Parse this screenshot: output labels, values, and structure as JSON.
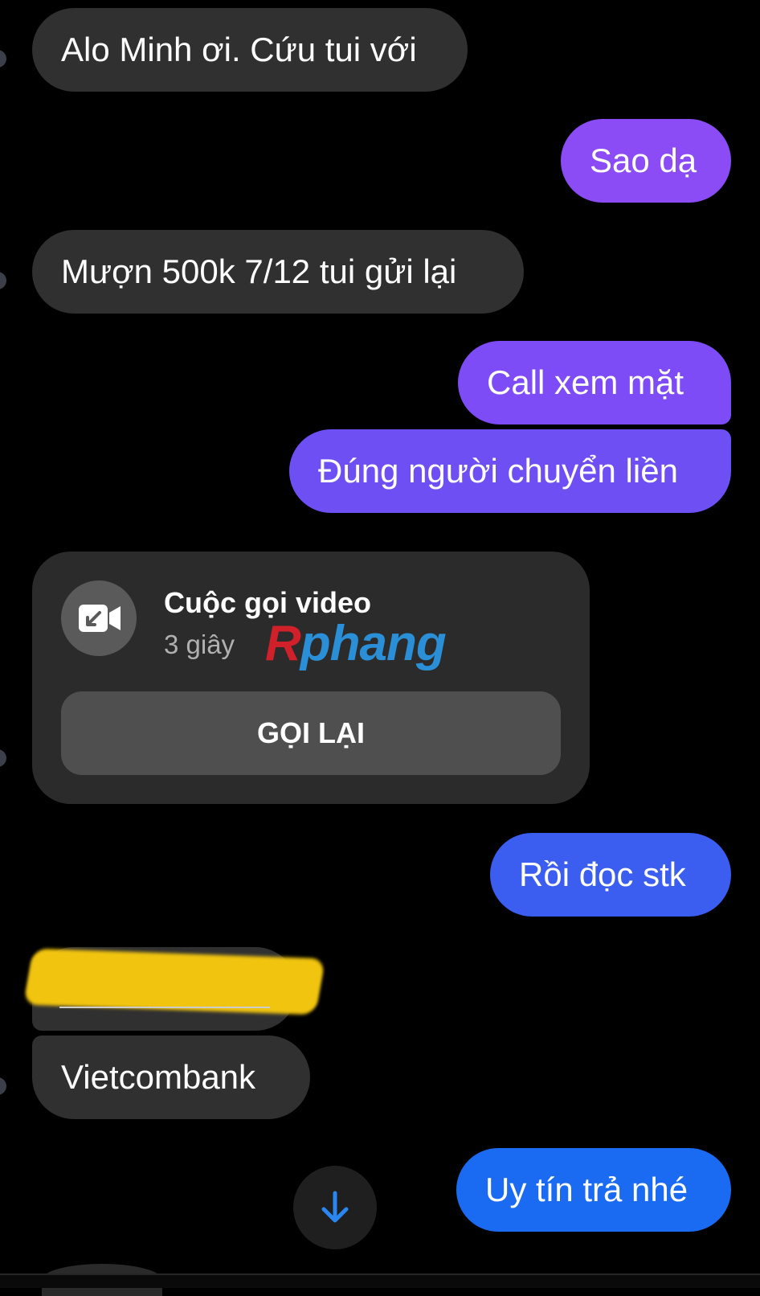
{
  "messages": [
    {
      "side": "in",
      "text": "Alo Minh ơi. Cứu tui với"
    },
    {
      "side": "out",
      "text": "Sao dạ"
    },
    {
      "side": "in",
      "text": "Mượn 500k 7/12 tui gửi lại"
    },
    {
      "side": "out",
      "text": "Call xem mặt"
    },
    {
      "side": "out",
      "text": "Đúng người chuyển liền"
    },
    {
      "side": "out",
      "text": "Rồi đọc stk"
    },
    {
      "side": "in",
      "text": "Vietcombank"
    },
    {
      "side": "out",
      "text": "Uy tín trả nhé"
    }
  ],
  "call_card": {
    "title": "Cuộc gọi video",
    "duration": "3 giây",
    "callback_label": "GỌI LẠI",
    "icon": "video-call-icon"
  },
  "watermark": {
    "part1": "R",
    "part2": "phang"
  },
  "scroll_button_icon": "arrow-down-icon",
  "colors": {
    "background": "#000000",
    "incoming_bubble": "#303030",
    "outgoing_purple": "#7b4cf6",
    "outgoing_blue": "#3b5df0",
    "outgoing_bright_blue": "#1a6bf2",
    "redaction": "#f1c40f"
  }
}
